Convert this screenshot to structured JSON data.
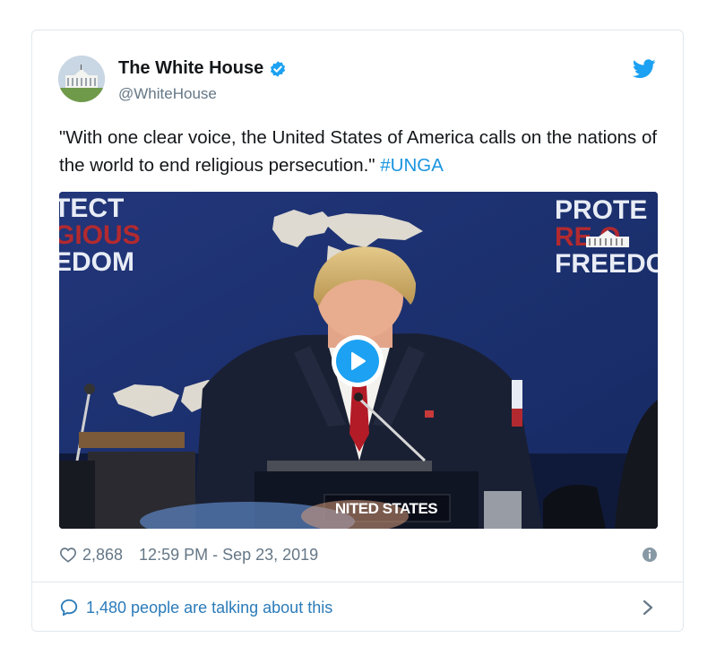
{
  "tweet": {
    "author_name": "The White House",
    "author_handle": "@WhiteHouse",
    "text_main": "\"With one clear voice, the United States of America calls on the nations of the world to end religious persecution.\" ",
    "hashtag": "#UNGA",
    "icons": {
      "verified": "verified-badge-icon",
      "brand": "twitter-bird-icon",
      "like": "heart-icon",
      "info": "info-icon",
      "reply": "speech-bubble-icon",
      "chevron": "chevron-right-icon",
      "play": "play-icon"
    }
  },
  "video": {
    "backdrop_left_lines": [
      "TECT",
      "GIOUS",
      "EDOM"
    ],
    "backdrop_right_lines": [
      "PROTE",
      "RE    O",
      "FREEDO"
    ],
    "nameplate": "NITED STATES"
  },
  "meta": {
    "likes": "2,868",
    "timestamp": "12:59 PM - Sep 23, 2019"
  },
  "footer": {
    "talking": "1,480 people are talking about this"
  },
  "colors": {
    "accent": "#1da1f2",
    "link": "#1b95e0",
    "muted": "#657786",
    "border": "#e1e8ed"
  }
}
